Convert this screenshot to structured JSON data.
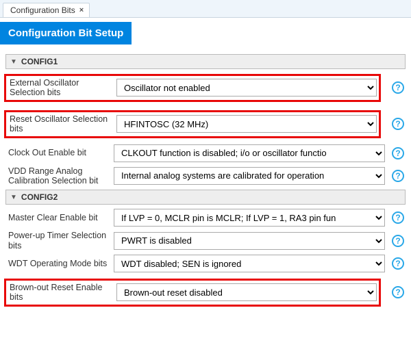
{
  "tab": {
    "label": "Configuration Bits"
  },
  "banner": "Configuration Bit Setup",
  "sections": [
    {
      "title": "CONFIG1"
    },
    {
      "title": "CONFIG2"
    }
  ],
  "config1": {
    "ext_osc": {
      "label": "External Oscillator Selection bits",
      "value": "Oscillator not enabled"
    },
    "rst_osc": {
      "label": "Reset Oscillator Selection bits",
      "value": "HFINTOSC (32 MHz)"
    },
    "clkout": {
      "label": "Clock Out Enable bit",
      "value": "CLKOUT function is disabled; i/o or oscillator functio"
    },
    "vdd_cal": {
      "label": "VDD Range Analog Calibration Selection bit",
      "value": "Internal analog systems are calibrated for operation"
    }
  },
  "config2": {
    "mclr": {
      "label": "Master Clear Enable bit",
      "value": "If LVP = 0, MCLR pin is MCLR; If LVP = 1, RA3 pin fun"
    },
    "pwrt": {
      "label": "Power-up Timer Selection bits",
      "value": "PWRT is disabled"
    },
    "wdt": {
      "label": "WDT Operating Mode bits",
      "value": "WDT disabled; SEN is ignored"
    },
    "bor": {
      "label": "Brown-out Reset Enable bits",
      "value": "Brown-out reset disabled"
    }
  }
}
